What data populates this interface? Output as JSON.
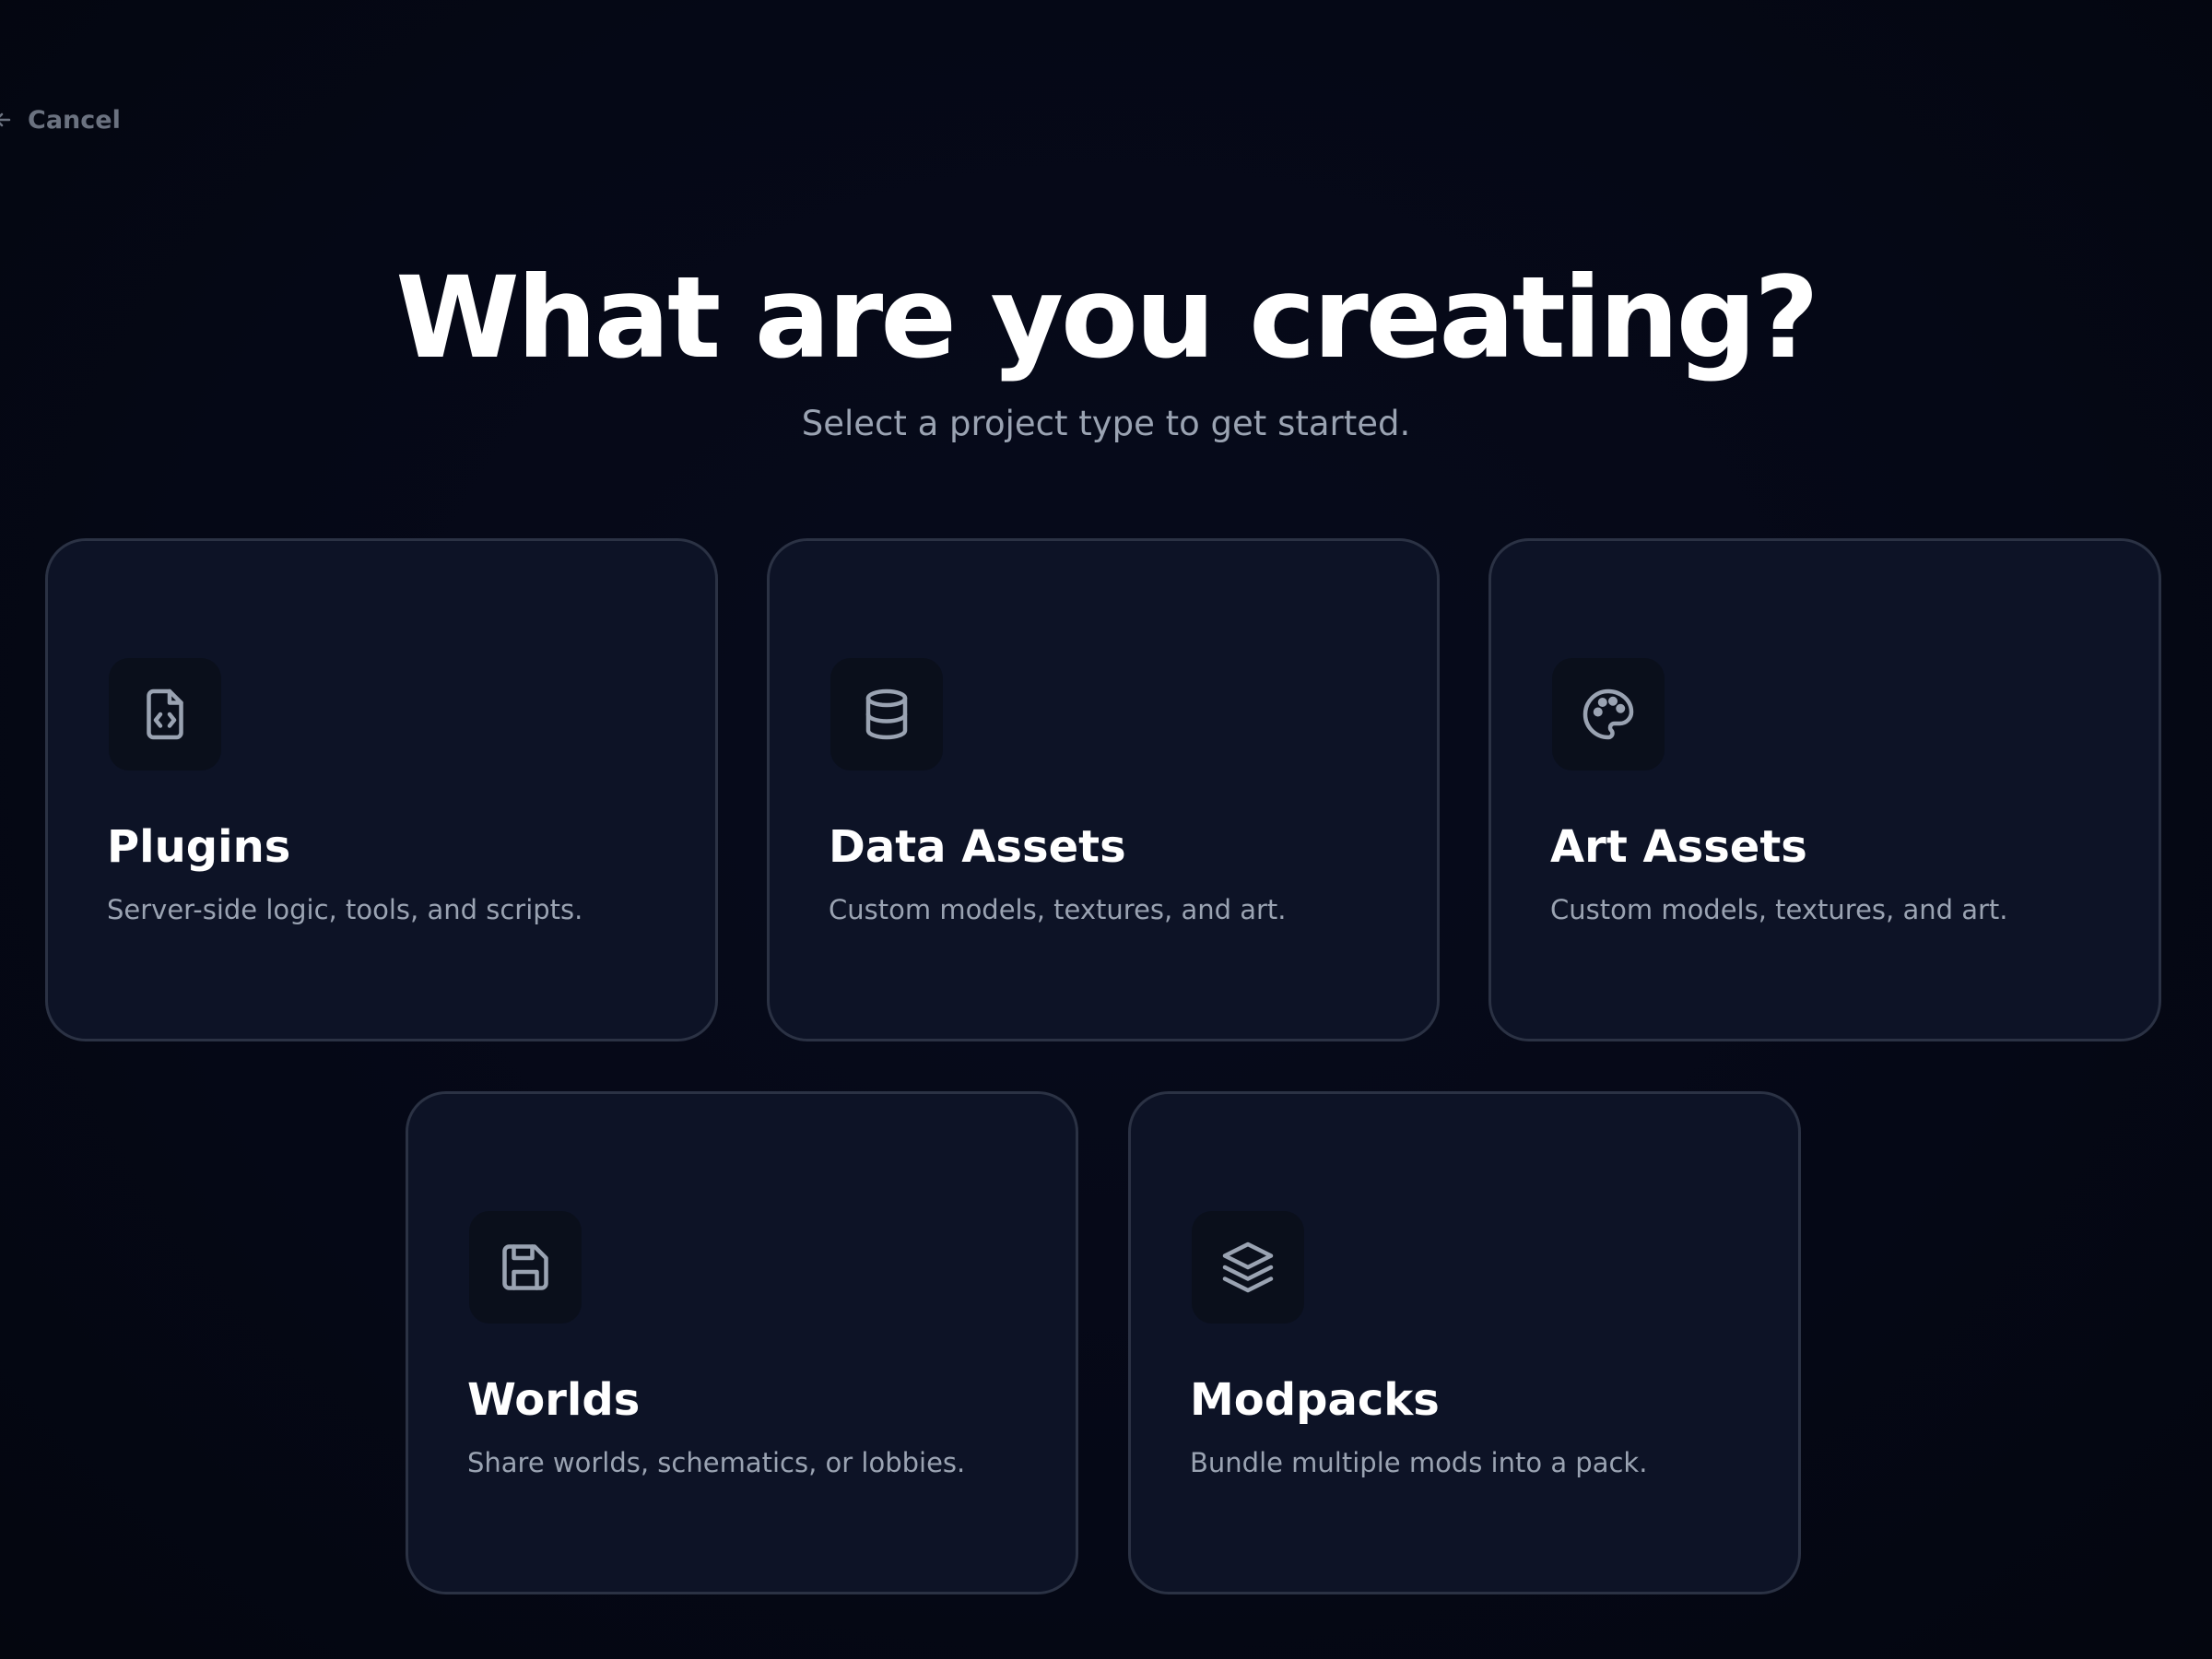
{
  "nav": {
    "cancel_label": "Cancel",
    "cancel_icon": "arrow-left-icon"
  },
  "header": {
    "title": "What are you creating?",
    "subtitle": "Select a project type to get started."
  },
  "colors": {
    "background": "#050816",
    "card_background": "#0d1326",
    "card_border": "#2b3244",
    "icon_color": "#9aa3b2",
    "title_color": "#ffffff",
    "muted_text": "#9aa3b2"
  },
  "project_types": [
    {
      "title": "Plugins",
      "description": "Server-side logic, tools, and scripts.",
      "icon": "file-code-icon"
    },
    {
      "title": "Data Assets",
      "description": "Custom models, textures, and art.",
      "icon": "database-icon"
    },
    {
      "title": "Art Assets",
      "description": "Custom models, textures, and art.",
      "icon": "palette-icon"
    },
    {
      "title": "Worlds",
      "description": "Share worlds, schematics, or lobbies.",
      "icon": "save-icon"
    },
    {
      "title": "Modpacks",
      "description": "Bundle multiple mods into a pack.",
      "icon": "layers-icon"
    }
  ]
}
